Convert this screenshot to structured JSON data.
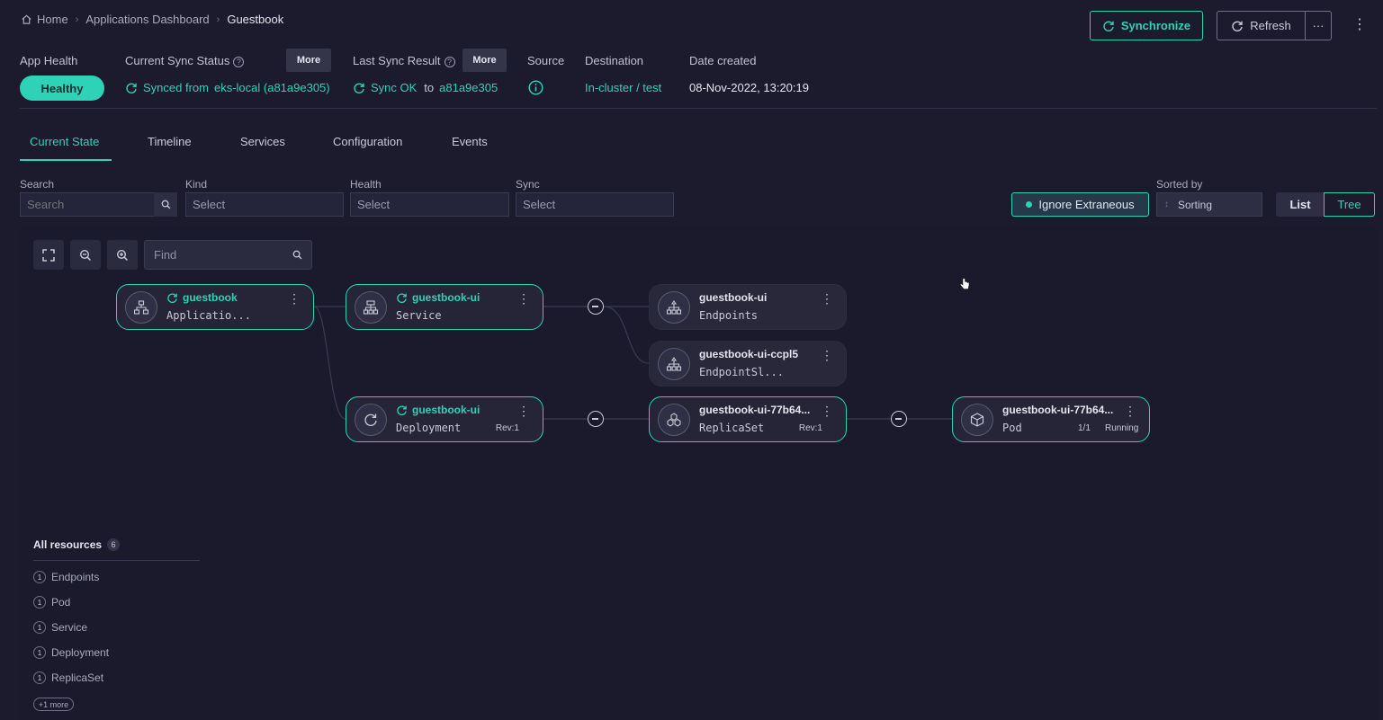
{
  "breadcrumb": {
    "home": "Home",
    "dashboard": "Applications Dashboard",
    "current": "Guestbook"
  },
  "toolbar": {
    "synchronize": "Synchronize",
    "refresh": "Refresh",
    "more": "···",
    "kebab": "⋮"
  },
  "status": {
    "app_health_label": "App Health",
    "app_health_value": "Healthy",
    "sync_status_label": "Current Sync Status",
    "more1": "More",
    "sync_status_prefix": "Synced from",
    "sync_status_target": "eks-local (a81a9e305)",
    "last_sync_label": "Last Sync Result",
    "more2": "More",
    "last_sync_ok": "Sync OK",
    "last_sync_to": "to",
    "last_sync_rev": "a81a9e305",
    "source_label": "Source",
    "destination_label": "Destination",
    "destination_value": "In-cluster / test",
    "date_label": "Date created",
    "date_value": "08-Nov-2022, 13:20:19"
  },
  "tabs": [
    "Current State",
    "Timeline",
    "Services",
    "Configuration",
    "Events"
  ],
  "filters": {
    "search_label": "Search",
    "search_placeholder": "Search",
    "kind_label": "Kind",
    "kind_value": "Select",
    "health_label": "Health",
    "health_value": "Select",
    "sync_label": "Sync",
    "sync_value": "Select",
    "ignore_extraneous": "Ignore Extraneous",
    "sorted_by_label": "Sorted by",
    "sorted_by_value": "Sorting",
    "view_list": "List",
    "view_tree": "Tree"
  },
  "graph": {
    "find_placeholder": "Find",
    "nodes": [
      {
        "name": "guestbook",
        "kind": "Applicatio...",
        "synced": true
      },
      {
        "name": "guestbook-ui",
        "kind": "Service",
        "synced": true
      },
      {
        "name": "guestbook-ui",
        "kind": "Endpoints",
        "synced": false
      },
      {
        "name": "guestbook-ui-ccpl5",
        "kind": "EndpointSl...",
        "synced": false
      },
      {
        "name": "guestbook-ui",
        "kind": "Deployment",
        "synced": true,
        "rev": "Rev:1"
      },
      {
        "name": "guestbook-ui-77b64...",
        "kind": "ReplicaSet",
        "synced": false,
        "rev": "Rev:1"
      },
      {
        "name": "guestbook-ui-77b64...",
        "kind": "Pod",
        "synced": false,
        "ready": "1/1",
        "status": "Running"
      }
    ]
  },
  "resources": {
    "title": "All resources",
    "count": "6",
    "items": [
      {
        "count": "1",
        "label": "Endpoints"
      },
      {
        "count": "1",
        "label": "Pod"
      },
      {
        "count": "1",
        "label": "Service"
      },
      {
        "count": "1",
        "label": "Deployment"
      },
      {
        "count": "1",
        "label": "ReplicaSet"
      }
    ],
    "more": "+1 more"
  },
  "colors": {
    "accent": "#2ed3b7",
    "background": "#1c1b2e",
    "canvas": "#1a1a2c"
  }
}
